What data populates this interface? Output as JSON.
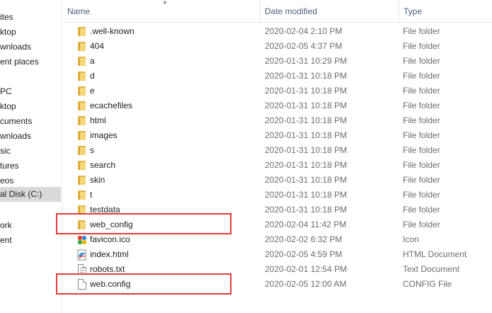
{
  "nav": {
    "items": [
      {
        "label": "ites"
      },
      {
        "label": "ktop"
      },
      {
        "label": "wnloads"
      },
      {
        "label": "ent places"
      },
      {
        "label": ""
      },
      {
        "label": "PC"
      },
      {
        "label": "ktop"
      },
      {
        "label": "cuments"
      },
      {
        "label": "wnloads"
      },
      {
        "label": "sic"
      },
      {
        "label": "tures"
      },
      {
        "label": "eos"
      },
      {
        "label": "al Disk (C:)"
      },
      {
        "label": ""
      },
      {
        "label": "ork"
      },
      {
        "label": "ent"
      }
    ],
    "selected": "al Disk (C:)"
  },
  "columns": {
    "name": "Name",
    "date": "Date modified",
    "type": "Type"
  },
  "files": [
    {
      "name": ".well-known",
      "date": "2020-02-04 2:10 PM",
      "type": "File folder",
      "icon": "folder-icon"
    },
    {
      "name": "404",
      "date": "2020-02-05 4:37 PM",
      "type": "File folder",
      "icon": "folder-icon"
    },
    {
      "name": "a",
      "date": "2020-01-31 10:29 PM",
      "type": "File folder",
      "icon": "folder-icon"
    },
    {
      "name": "d",
      "date": "2020-01-31 10:18 PM",
      "type": "File folder",
      "icon": "folder-icon"
    },
    {
      "name": "e",
      "date": "2020-01-31 10:18 PM",
      "type": "File folder",
      "icon": "folder-icon"
    },
    {
      "name": "ecachefiles",
      "date": "2020-01-31 10:18 PM",
      "type": "File folder",
      "icon": "folder-icon"
    },
    {
      "name": "html",
      "date": "2020-01-31 10:18 PM",
      "type": "File folder",
      "icon": "folder-icon"
    },
    {
      "name": "images",
      "date": "2020-01-31 10:18 PM",
      "type": "File folder",
      "icon": "folder-icon"
    },
    {
      "name": "s",
      "date": "2020-01-31 10:18 PM",
      "type": "File folder",
      "icon": "folder-icon"
    },
    {
      "name": "search",
      "date": "2020-01-31 10:18 PM",
      "type": "File folder",
      "icon": "folder-icon"
    },
    {
      "name": "skin",
      "date": "2020-01-31 10:18 PM",
      "type": "File folder",
      "icon": "folder-icon"
    },
    {
      "name": "t",
      "date": "2020-01-31 10:18 PM",
      "type": "File folder",
      "icon": "folder-icon"
    },
    {
      "name": "testdata",
      "date": "2020-01-31 10:18 PM",
      "type": "File folder",
      "icon": "folder-icon"
    },
    {
      "name": "web_config",
      "date": "2020-02-04 11:42 PM",
      "type": "File folder",
      "icon": "folder-icon",
      "highlighted": true
    },
    {
      "name": "favicon.ico",
      "date": "2020-02-02 6:32 PM",
      "type": "Icon",
      "icon": "favicon-icon"
    },
    {
      "name": "index.html",
      "date": "2020-02-05 4:59 PM",
      "type": "HTML Document",
      "icon": "html-file-icon"
    },
    {
      "name": "robots.txt",
      "date": "2020-02-01 12:54 PM",
      "type": "Text Document",
      "icon": "text-file-icon"
    },
    {
      "name": "web.config",
      "date": "2020-02-05 12:00 AM",
      "type": "CONFIG File",
      "icon": "blank-file-icon",
      "highlighted": true
    }
  ],
  "colors": {
    "highlight": "#e53b3b",
    "header_text": "#4c607a",
    "detail_text": "#6d6d6d",
    "folder": "#f5d77a"
  }
}
